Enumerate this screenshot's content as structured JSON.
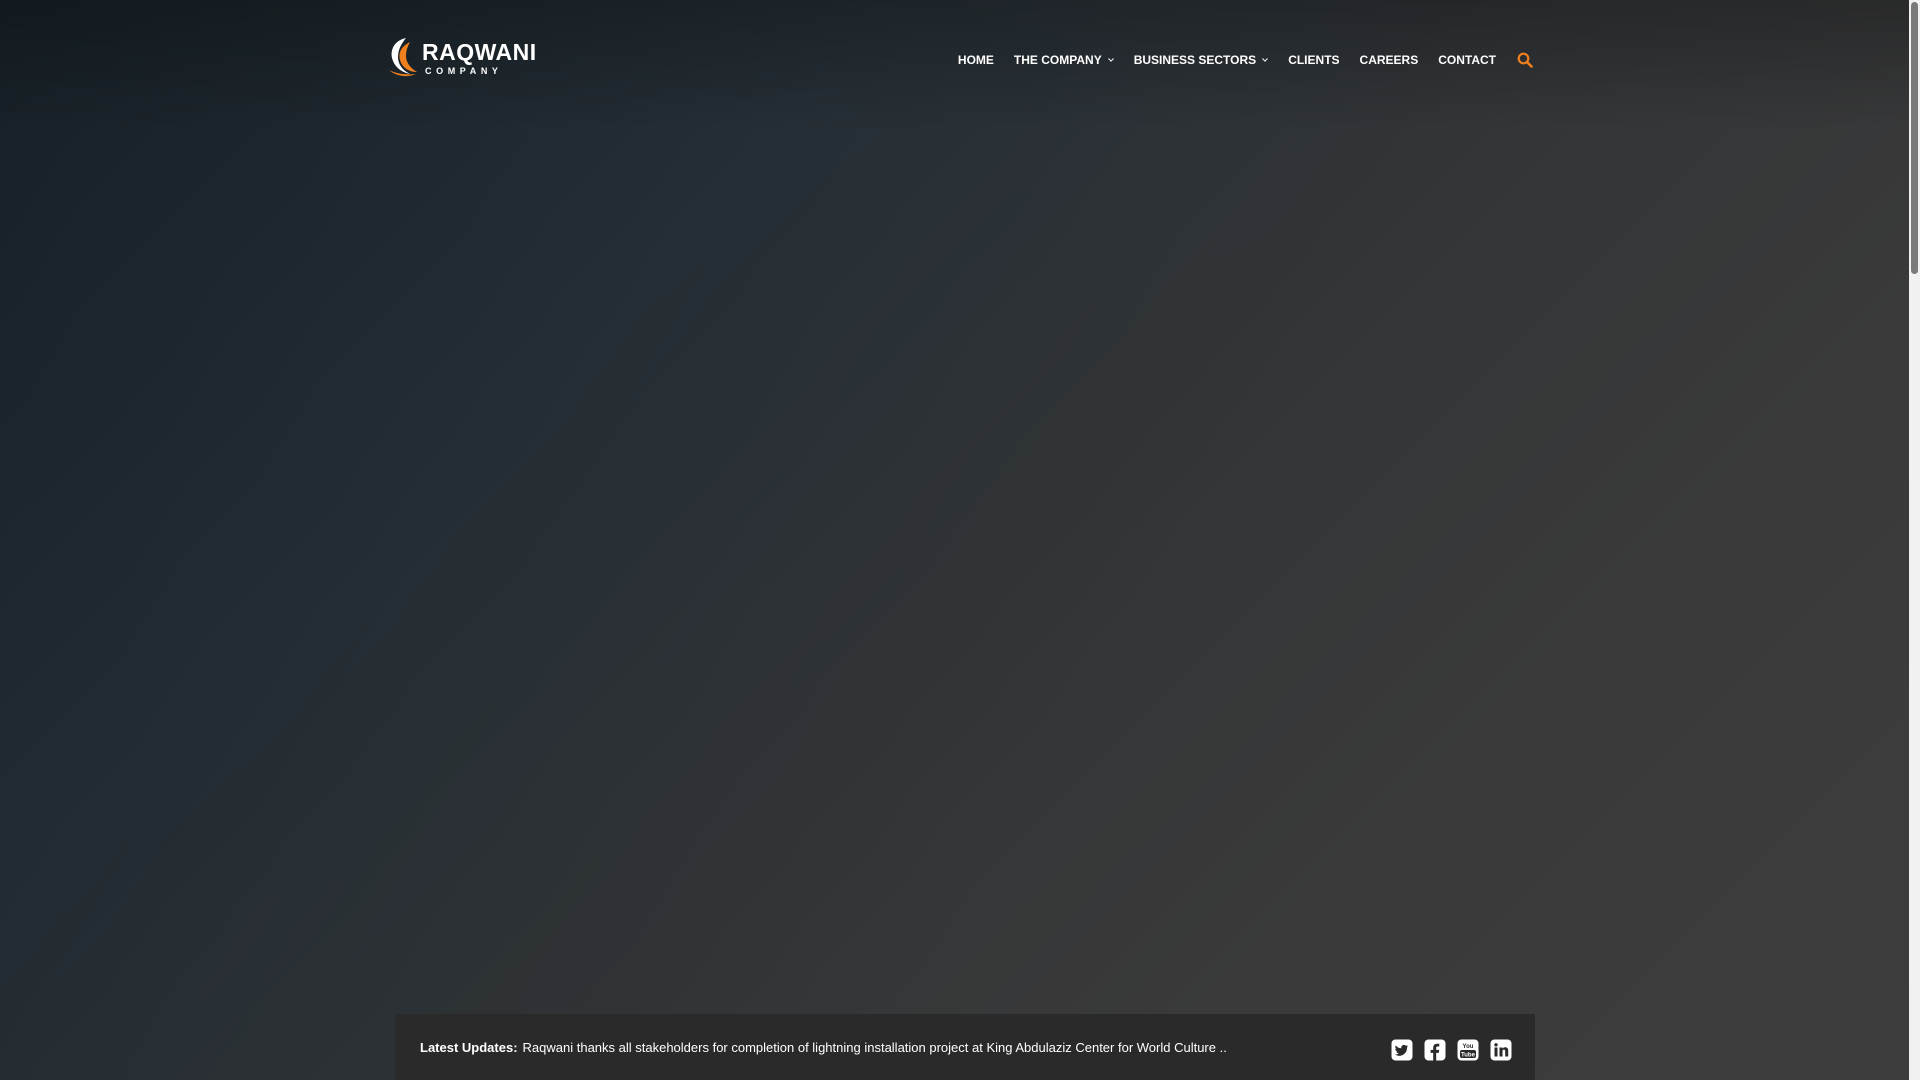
{
  "brand": {
    "name": "RAQWANI",
    "sub": "COMPANY",
    "accent": "#f07f1e"
  },
  "nav": {
    "items": [
      {
        "label": "HOME"
      },
      {
        "label": "THE COMPANY"
      },
      {
        "label": "BUSINESS SECTORS"
      },
      {
        "label": "CLIENTS"
      },
      {
        "label": "CAREERS"
      },
      {
        "label": "CONTACT"
      }
    ],
    "search_icon": "search-icon",
    "search_color": "#f07f1e"
  },
  "ticker": {
    "label": "Latest Updates:",
    "text": "Raqwani thanks all stakeholders for completion of lightning installation project at King Abdulaziz Center for World Culture .."
  },
  "socials": [
    {
      "icon": "twitter-icon"
    },
    {
      "icon": "facebook-icon"
    },
    {
      "icon": "youtube-icon"
    },
    {
      "icon": "linkedin-icon"
    }
  ]
}
